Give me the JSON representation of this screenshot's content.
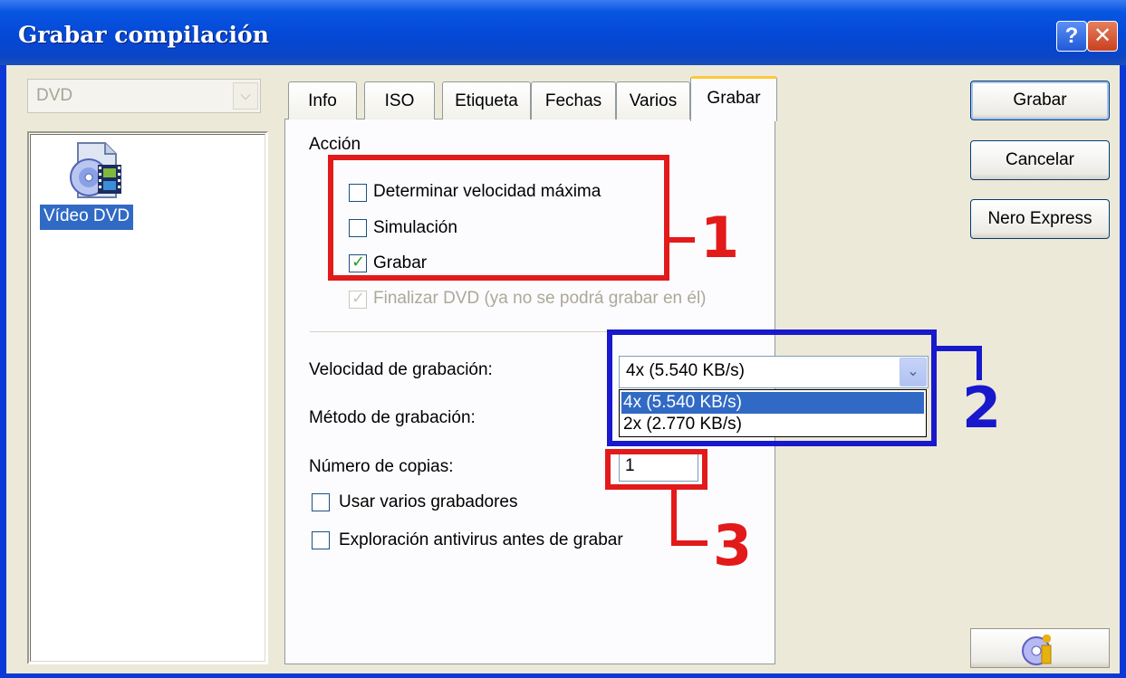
{
  "window": {
    "title": "Grabar compilación",
    "help_glyph": "?",
    "close_glyph": "✕"
  },
  "left": {
    "combo_value": "DVD",
    "compilation_item": "Vídeo DVD"
  },
  "tabs": [
    {
      "label": "Info"
    },
    {
      "label": "ISO"
    },
    {
      "label": "Etiqueta"
    },
    {
      "label": "Fechas"
    },
    {
      "label": "Varios"
    },
    {
      "label": "Grabar",
      "active": true
    }
  ],
  "action": {
    "group_label": "Acción",
    "options": [
      {
        "label": "Determinar velocidad máxima",
        "checked": false
      },
      {
        "label": "Simulación",
        "checked": false
      },
      {
        "label": "Grabar",
        "checked": true
      },
      {
        "label": "Finalizar DVD (ya no se podrá grabar en él)",
        "checked": true,
        "disabled": true
      }
    ]
  },
  "settings": {
    "speed_label": "Velocidad de grabación:",
    "speed_value": "4x (5.540 KB/s)",
    "speed_options": [
      "4x (5.540 KB/s)",
      "2x (2.770 KB/s)"
    ],
    "method_label": "Método de grabación:",
    "copies_label": "Número de copias:",
    "copies_value": "1",
    "multi_recorder_label": "Usar varios grabadores",
    "antivirus_label": "Exploración antivirus antes de grabar"
  },
  "buttons": {
    "burn": "Grabar",
    "cancel": "Cancelar",
    "nero_express": "Nero Express"
  },
  "annotations": {
    "marker_1": "1",
    "marker_2": "2",
    "marker_3": "3",
    "red": "#e21a1a",
    "blue": "#1818cc"
  },
  "colors": {
    "titlebar": "#0448d6",
    "selection": "#316ac5",
    "dialog_bg": "#ece9d8",
    "tab_highlight": "#ffc83c"
  }
}
